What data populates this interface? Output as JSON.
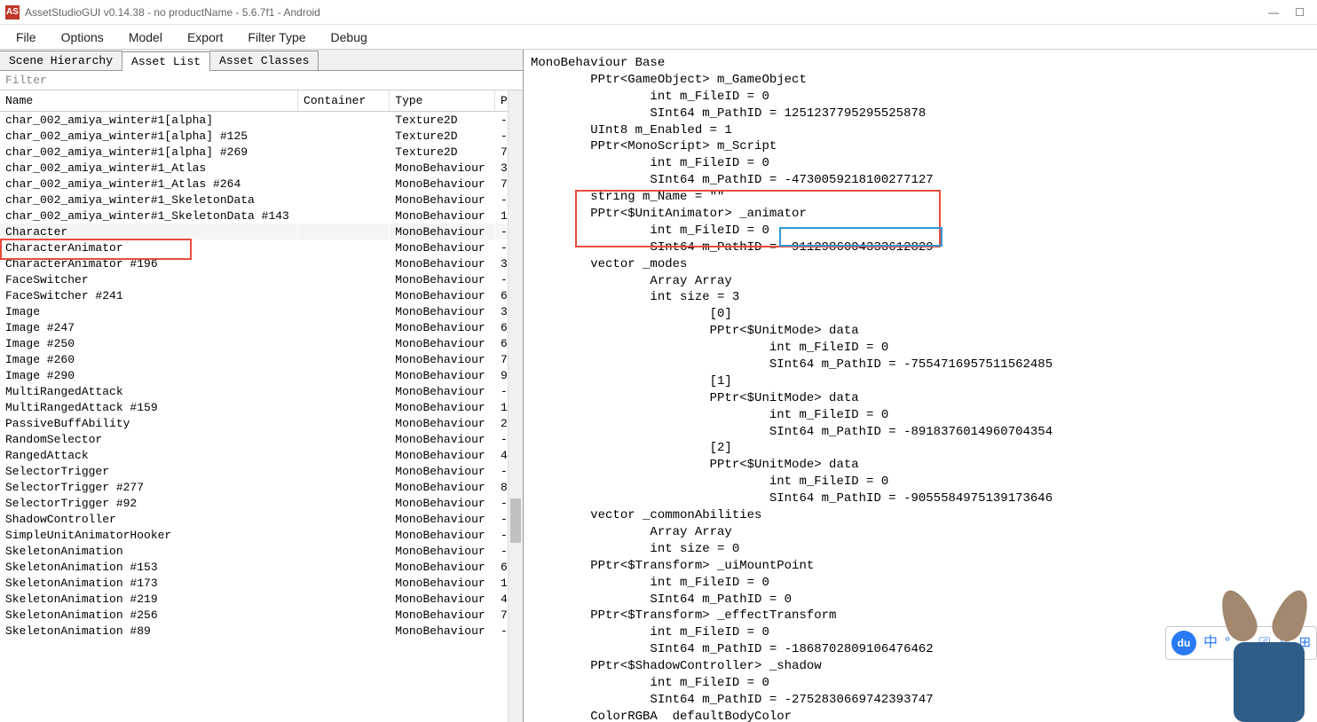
{
  "window": {
    "app_icon_text": "AS",
    "title": "AssetStudioGUI v0.14.38 - no productName - 5.6.7f1 - Android"
  },
  "menu": [
    "File",
    "Options",
    "Model",
    "Export",
    "Filter Type",
    "Debug"
  ],
  "tabs": {
    "items": [
      "Scene Hierarchy",
      "Asset List",
      "Asset Classes"
    ],
    "active_index": 1
  },
  "filter_placeholder": "Filter",
  "columns": {
    "name": "Name",
    "container": "Container",
    "type": "Type",
    "p": "P"
  },
  "rows": [
    {
      "name": "char_002_amiya_winter#1[alpha]",
      "type": "Texture2D",
      "p": "-"
    },
    {
      "name": "char_002_amiya_winter#1[alpha] #125",
      "type": "Texture2D",
      "p": "-"
    },
    {
      "name": "char_002_amiya_winter#1[alpha] #269",
      "type": "Texture2D",
      "p": "7"
    },
    {
      "name": "char_002_amiya_winter#1_Atlas",
      "type": "MonoBehaviour",
      "p": "3"
    },
    {
      "name": "char_002_amiya_winter#1_Atlas #264",
      "type": "MonoBehaviour",
      "p": "7"
    },
    {
      "name": "char_002_amiya_winter#1_SkeletonData",
      "type": "MonoBehaviour",
      "p": "-"
    },
    {
      "name": "char_002_amiya_winter#1_SkeletonData #143",
      "type": "MonoBehaviour",
      "p": "1"
    },
    {
      "name": "Character",
      "type": "MonoBehaviour",
      "p": "-",
      "selected": true,
      "highlight": true
    },
    {
      "name": "CharacterAnimator",
      "type": "MonoBehaviour",
      "p": "-"
    },
    {
      "name": "CharacterAnimator #196",
      "type": "MonoBehaviour",
      "p": "3"
    },
    {
      "name": "FaceSwitcher",
      "type": "MonoBehaviour",
      "p": "-"
    },
    {
      "name": "FaceSwitcher #241",
      "type": "MonoBehaviour",
      "p": "6"
    },
    {
      "name": "Image",
      "type": "MonoBehaviour",
      "p": "3"
    },
    {
      "name": "Image #247",
      "type": "MonoBehaviour",
      "p": "6"
    },
    {
      "name": "Image #250",
      "type": "MonoBehaviour",
      "p": "6"
    },
    {
      "name": "Image #260",
      "type": "MonoBehaviour",
      "p": "7"
    },
    {
      "name": "Image #290",
      "type": "MonoBehaviour",
      "p": "9"
    },
    {
      "name": "MultiRangedAttack",
      "type": "MonoBehaviour",
      "p": "-"
    },
    {
      "name": "MultiRangedAttack #159",
      "type": "MonoBehaviour",
      "p": "1"
    },
    {
      "name": "PassiveBuffAbility",
      "type": "MonoBehaviour",
      "p": "2"
    },
    {
      "name": "RandomSelector",
      "type": "MonoBehaviour",
      "p": "-"
    },
    {
      "name": "RangedAttack",
      "type": "MonoBehaviour",
      "p": "4"
    },
    {
      "name": "SelectorTrigger",
      "type": "MonoBehaviour",
      "p": "-"
    },
    {
      "name": "SelectorTrigger #277",
      "type": "MonoBehaviour",
      "p": "8"
    },
    {
      "name": "SelectorTrigger #92",
      "type": "MonoBehaviour",
      "p": "-"
    },
    {
      "name": "ShadowController",
      "type": "MonoBehaviour",
      "p": "-"
    },
    {
      "name": "SimpleUnitAnimatorHooker",
      "type": "MonoBehaviour",
      "p": "-"
    },
    {
      "name": "SkeletonAnimation",
      "type": "MonoBehaviour",
      "p": "-"
    },
    {
      "name": "SkeletonAnimation #153",
      "type": "MonoBehaviour",
      "p": "6"
    },
    {
      "name": "SkeletonAnimation #173",
      "type": "MonoBehaviour",
      "p": "1"
    },
    {
      "name": "SkeletonAnimation #219",
      "type": "MonoBehaviour",
      "p": "4"
    },
    {
      "name": "SkeletonAnimation #256",
      "type": "MonoBehaviour",
      "p": "7"
    },
    {
      "name": "SkeletonAnimation #89",
      "type": "MonoBehaviour",
      "p": "-"
    }
  ],
  "detail_lines": [
    "MonoBehaviour Base",
    "    PPtr<GameObject> m_GameObject",
    "        int m_FileID = 0",
    "        SInt64 m_PathID = 1251237795295525878",
    "    UInt8 m_Enabled = 1",
    "    PPtr<MonoScript> m_Script",
    "        int m_FileID = 0",
    "        SInt64 m_PathID = -4730059218100277127",
    "    string m_Name = \"\"",
    "    PPtr<$UnitAnimator> _animator",
    "        int m_FileID = 0",
    "        SInt64 m_PathID = -9112986004333612829",
    "    vector _modes",
    "        Array Array",
    "        int size = 3",
    "            [0]",
    "            PPtr<$UnitMode> data",
    "                int m_FileID = 0",
    "                SInt64 m_PathID = -7554716957511562485",
    "            [1]",
    "            PPtr<$UnitMode> data",
    "                int m_FileID = 0",
    "                SInt64 m_PathID = -8918376014960704354",
    "            [2]",
    "            PPtr<$UnitMode> data",
    "                int m_FileID = 0",
    "                SInt64 m_PathID = -9055584975139173646",
    "    vector _commonAbilities",
    "        Array Array",
    "        int size = 0",
    "    PPtr<$Transform> _uiMountPoint",
    "        int m_FileID = 0",
    "        SInt64 m_PathID = 0",
    "    PPtr<$Transform> _effectTransform",
    "        int m_FileID = 0",
    "        SInt64 m_PathID = -1868702809106476462",
    "    PPtr<$ShadowController> _shadow",
    "        int m_FileID = 0",
    "        SInt64 m_PathID = -2752830669742393747",
    "    ColorRGBA  defaultBodyColor"
  ],
  "overlay": {
    "baidu": "du",
    "lang": "中",
    "dot": "°",
    "comma": "，"
  }
}
